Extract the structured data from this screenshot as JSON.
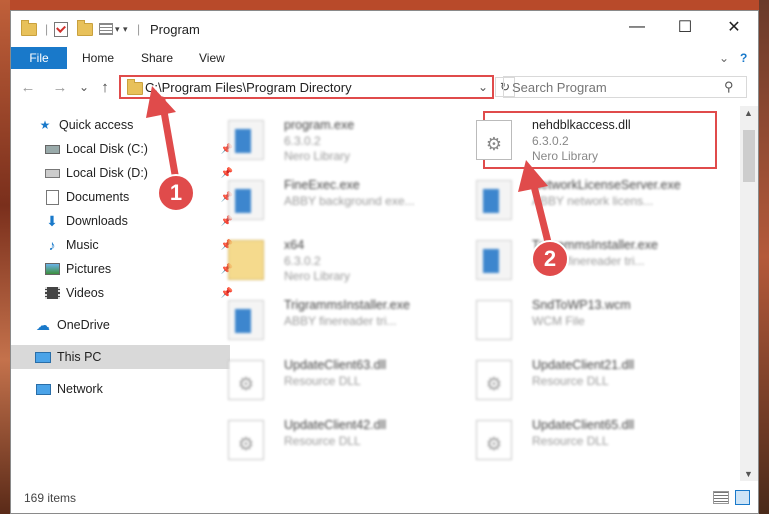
{
  "window": {
    "title": "Program",
    "minimize": "—",
    "maximize": "☐",
    "close": "✕"
  },
  "ribbon": {
    "tabs": [
      "File",
      "Home",
      "Share",
      "View"
    ],
    "expand": "⌄",
    "help": "?"
  },
  "nav": {
    "back": "←",
    "forward": "→",
    "recent": "⌄",
    "up": "↑",
    "address": "C:\\Program Files\\Program Directory",
    "address_dropdown": "⌄",
    "refresh": "↻",
    "search_placeholder": "Search Program",
    "search_icon": "⚲"
  },
  "sidebar": {
    "items": [
      {
        "label": "Quick access",
        "icon": "star-icon",
        "pinned": false
      },
      {
        "label": "Local Disk (C:)",
        "icon": "drive-icon",
        "pinned": true
      },
      {
        "label": "Local Disk (D:)",
        "icon": "drive-icon",
        "pinned": true
      },
      {
        "label": "Documents",
        "icon": "documents-icon",
        "pinned": true
      },
      {
        "label": "Downloads",
        "icon": "download-icon",
        "pinned": true
      },
      {
        "label": "Music",
        "icon": "music-icon",
        "pinned": true
      },
      {
        "label": "Pictures",
        "icon": "pictures-icon",
        "pinned": true
      },
      {
        "label": "Videos",
        "icon": "videos-icon",
        "pinned": true
      },
      {
        "label": "OneDrive",
        "icon": "cloud-icon",
        "pinned": false
      },
      {
        "label": "This PC",
        "icon": "computer-icon",
        "pinned": false
      },
      {
        "label": "Network",
        "icon": "network-icon",
        "pinned": false
      }
    ]
  },
  "files": [
    {
      "name": "program.exe",
      "line2": "6.3.0.2",
      "line3": "Nero Library"
    },
    {
      "name": "nehdblkaccess.dll",
      "line2": "6.3.0.2",
      "line3": "Nero Library"
    },
    {
      "name": "FineExec.exe",
      "line2": "ABBY background exe...",
      "line3": ""
    },
    {
      "name": "NetworkLicenseServer.exe",
      "line2": "ABBY network licens...",
      "line3": ""
    },
    {
      "name": "x64",
      "line2": "6.3.0.2",
      "line3": "Nero Library"
    },
    {
      "name": "TrigrammsInstaller.exe",
      "line2": "ABBY finereader tri...",
      "line3": ""
    },
    {
      "name": "TrigrammsInstaller.exe",
      "line2": "ABBY finereader tri...",
      "line3": ""
    },
    {
      "name": "SndToWP13.wcm",
      "line2": "WCM File",
      "line3": ""
    },
    {
      "name": "UpdateClient63.dll",
      "line2": "Resource DLL",
      "line3": ""
    },
    {
      "name": "UpdateClient21.dll",
      "line2": "Resource DLL",
      "line3": ""
    },
    {
      "name": "UpdateClient42.dll",
      "line2": "Resource DLL",
      "line3": ""
    },
    {
      "name": "UpdateClient65.dll",
      "line2": "Resource DLL",
      "line3": ""
    }
  ],
  "status": {
    "count": "169 items"
  },
  "annotations": {
    "step1": "1",
    "step2": "2"
  },
  "colors": {
    "accent": "#1979ca",
    "highlight": "#e04b4b"
  }
}
